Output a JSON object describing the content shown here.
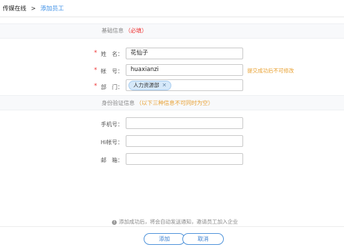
{
  "breadcrumb": {
    "root": "传媒在线",
    "separator": ">",
    "current": "添加员工"
  },
  "sections": {
    "basic": {
      "title": "基础信息",
      "required": "（必填）"
    },
    "identity": {
      "title": "身份验证信息",
      "hint": "（以下三种信息不可同时为空）"
    }
  },
  "form": {
    "name": {
      "label": "姓　名：",
      "value": "花仙子"
    },
    "account": {
      "label": "帐　号：",
      "value": "huaxianzi",
      "note": "提交成功后不可修改"
    },
    "department": {
      "label": "部　门：",
      "tag": "人力资源部",
      "tag_remove": "✕"
    },
    "phone": {
      "label": "手机号：",
      "value": ""
    },
    "hi_account": {
      "label": "Hi帐号：",
      "value": ""
    },
    "email": {
      "label": "邮　箱：",
      "value": ""
    }
  },
  "footer": {
    "note": "添加成功后，将会自动发送通知，邀请员工加入企业",
    "info_icon": "info-icon"
  },
  "buttons": {
    "add": "添加",
    "cancel": "取消"
  },
  "colors": {
    "accent": "#3a8ee6",
    "required": "#e33333",
    "warning": "#e8a030",
    "tag_bg": "#d6e9fa"
  }
}
